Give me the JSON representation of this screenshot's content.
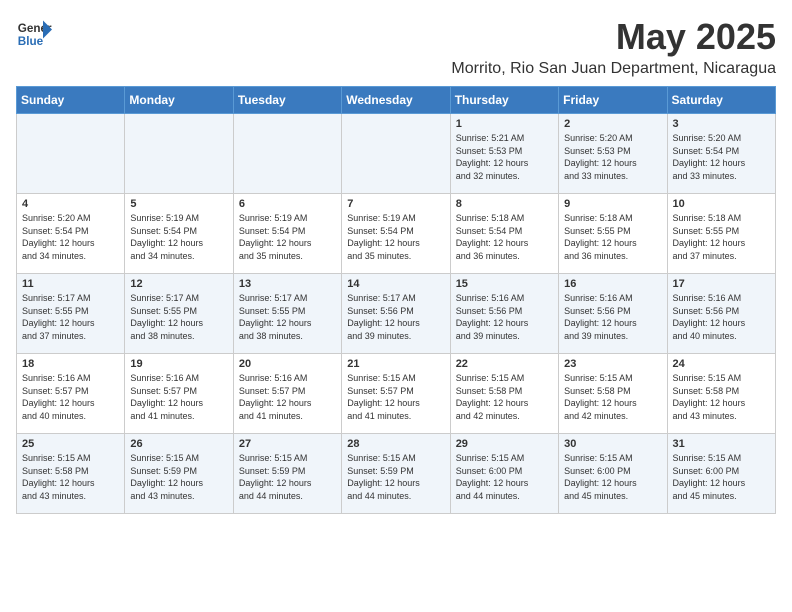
{
  "header": {
    "logo_general": "General",
    "logo_blue": "Blue",
    "title": "May 2025",
    "subtitle": "Morrito, Rio San Juan Department, Nicaragua"
  },
  "calendar": {
    "days_of_week": [
      "Sunday",
      "Monday",
      "Tuesday",
      "Wednesday",
      "Thursday",
      "Friday",
      "Saturday"
    ],
    "weeks": [
      [
        {
          "day": "",
          "info": ""
        },
        {
          "day": "",
          "info": ""
        },
        {
          "day": "",
          "info": ""
        },
        {
          "day": "",
          "info": ""
        },
        {
          "day": "1",
          "info": "Sunrise: 5:21 AM\nSunset: 5:53 PM\nDaylight: 12 hours\nand 32 minutes."
        },
        {
          "day": "2",
          "info": "Sunrise: 5:20 AM\nSunset: 5:53 PM\nDaylight: 12 hours\nand 33 minutes."
        },
        {
          "day": "3",
          "info": "Sunrise: 5:20 AM\nSunset: 5:54 PM\nDaylight: 12 hours\nand 33 minutes."
        }
      ],
      [
        {
          "day": "4",
          "info": "Sunrise: 5:20 AM\nSunset: 5:54 PM\nDaylight: 12 hours\nand 34 minutes."
        },
        {
          "day": "5",
          "info": "Sunrise: 5:19 AM\nSunset: 5:54 PM\nDaylight: 12 hours\nand 34 minutes."
        },
        {
          "day": "6",
          "info": "Sunrise: 5:19 AM\nSunset: 5:54 PM\nDaylight: 12 hours\nand 35 minutes."
        },
        {
          "day": "7",
          "info": "Sunrise: 5:19 AM\nSunset: 5:54 PM\nDaylight: 12 hours\nand 35 minutes."
        },
        {
          "day": "8",
          "info": "Sunrise: 5:18 AM\nSunset: 5:54 PM\nDaylight: 12 hours\nand 36 minutes."
        },
        {
          "day": "9",
          "info": "Sunrise: 5:18 AM\nSunset: 5:55 PM\nDaylight: 12 hours\nand 36 minutes."
        },
        {
          "day": "10",
          "info": "Sunrise: 5:18 AM\nSunset: 5:55 PM\nDaylight: 12 hours\nand 37 minutes."
        }
      ],
      [
        {
          "day": "11",
          "info": "Sunrise: 5:17 AM\nSunset: 5:55 PM\nDaylight: 12 hours\nand 37 minutes."
        },
        {
          "day": "12",
          "info": "Sunrise: 5:17 AM\nSunset: 5:55 PM\nDaylight: 12 hours\nand 38 minutes."
        },
        {
          "day": "13",
          "info": "Sunrise: 5:17 AM\nSunset: 5:55 PM\nDaylight: 12 hours\nand 38 minutes."
        },
        {
          "day": "14",
          "info": "Sunrise: 5:17 AM\nSunset: 5:56 PM\nDaylight: 12 hours\nand 39 minutes."
        },
        {
          "day": "15",
          "info": "Sunrise: 5:16 AM\nSunset: 5:56 PM\nDaylight: 12 hours\nand 39 minutes."
        },
        {
          "day": "16",
          "info": "Sunrise: 5:16 AM\nSunset: 5:56 PM\nDaylight: 12 hours\nand 39 minutes."
        },
        {
          "day": "17",
          "info": "Sunrise: 5:16 AM\nSunset: 5:56 PM\nDaylight: 12 hours\nand 40 minutes."
        }
      ],
      [
        {
          "day": "18",
          "info": "Sunrise: 5:16 AM\nSunset: 5:57 PM\nDaylight: 12 hours\nand 40 minutes."
        },
        {
          "day": "19",
          "info": "Sunrise: 5:16 AM\nSunset: 5:57 PM\nDaylight: 12 hours\nand 41 minutes."
        },
        {
          "day": "20",
          "info": "Sunrise: 5:16 AM\nSunset: 5:57 PM\nDaylight: 12 hours\nand 41 minutes."
        },
        {
          "day": "21",
          "info": "Sunrise: 5:15 AM\nSunset: 5:57 PM\nDaylight: 12 hours\nand 41 minutes."
        },
        {
          "day": "22",
          "info": "Sunrise: 5:15 AM\nSunset: 5:58 PM\nDaylight: 12 hours\nand 42 minutes."
        },
        {
          "day": "23",
          "info": "Sunrise: 5:15 AM\nSunset: 5:58 PM\nDaylight: 12 hours\nand 42 minutes."
        },
        {
          "day": "24",
          "info": "Sunrise: 5:15 AM\nSunset: 5:58 PM\nDaylight: 12 hours\nand 43 minutes."
        }
      ],
      [
        {
          "day": "25",
          "info": "Sunrise: 5:15 AM\nSunset: 5:58 PM\nDaylight: 12 hours\nand 43 minutes."
        },
        {
          "day": "26",
          "info": "Sunrise: 5:15 AM\nSunset: 5:59 PM\nDaylight: 12 hours\nand 43 minutes."
        },
        {
          "day": "27",
          "info": "Sunrise: 5:15 AM\nSunset: 5:59 PM\nDaylight: 12 hours\nand 44 minutes."
        },
        {
          "day": "28",
          "info": "Sunrise: 5:15 AM\nSunset: 5:59 PM\nDaylight: 12 hours\nand 44 minutes."
        },
        {
          "day": "29",
          "info": "Sunrise: 5:15 AM\nSunset: 6:00 PM\nDaylight: 12 hours\nand 44 minutes."
        },
        {
          "day": "30",
          "info": "Sunrise: 5:15 AM\nSunset: 6:00 PM\nDaylight: 12 hours\nand 45 minutes."
        },
        {
          "day": "31",
          "info": "Sunrise: 5:15 AM\nSunset: 6:00 PM\nDaylight: 12 hours\nand 45 minutes."
        }
      ]
    ]
  }
}
